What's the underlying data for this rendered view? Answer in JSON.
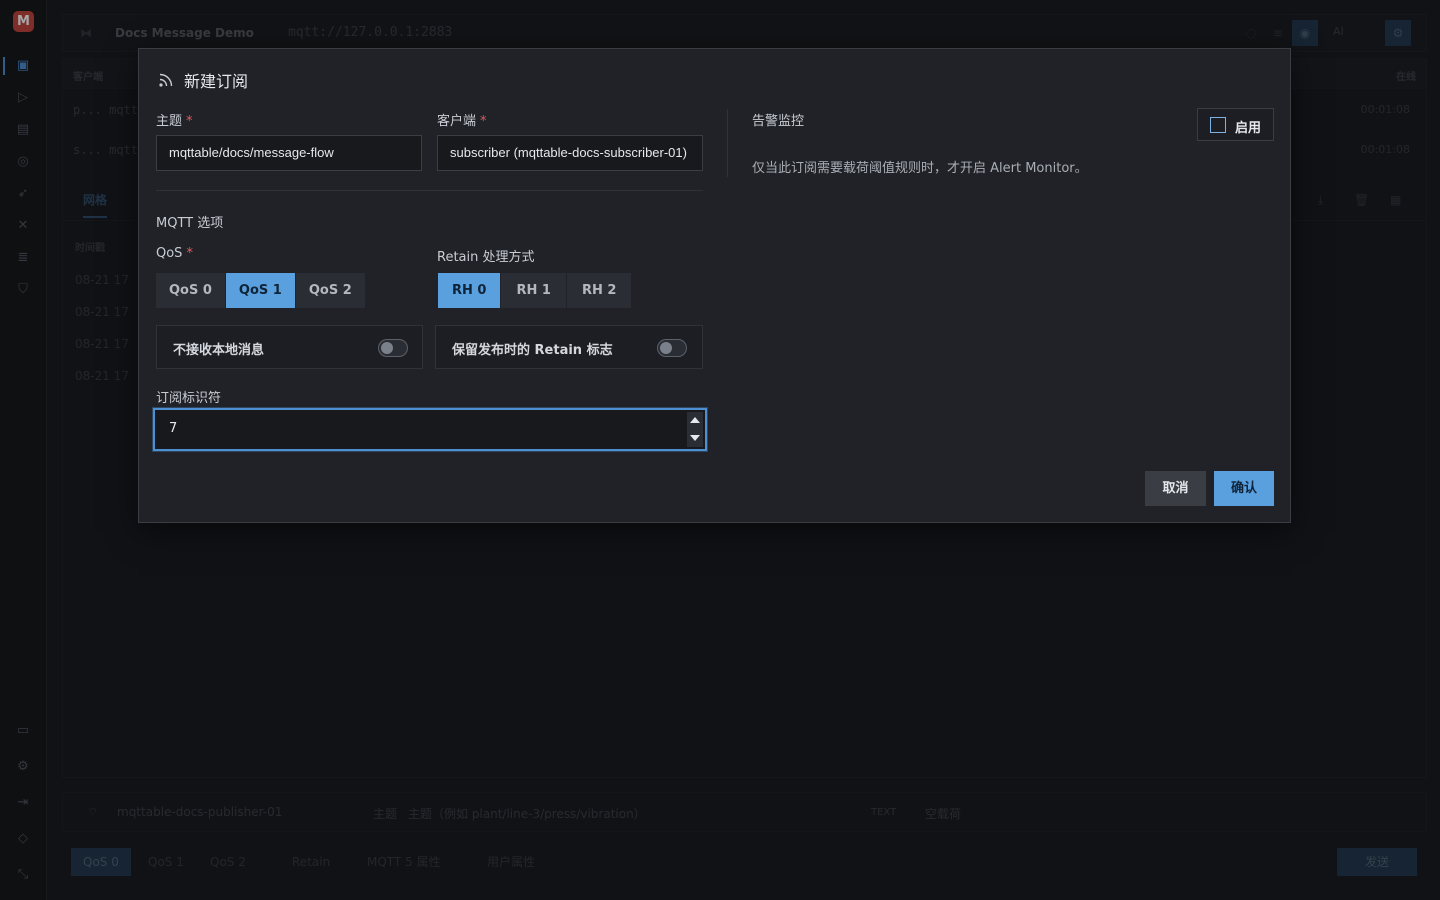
{
  "app": {
    "logo_letter": "M",
    "window_title": "Docs Message Demo",
    "broker_url": "mqtt://127.0.0.1:2883",
    "ai_label": "AI"
  },
  "background": {
    "clients_header": "客户端",
    "online_header": "在线",
    "clients": [
      {
        "name": "p... mqtta",
        "time": "00:01:08"
      },
      {
        "name": "s... mqtta",
        "time": "00:01:08"
      }
    ],
    "tab_grid": "网格",
    "time_header": "时间戳",
    "timestamps": [
      "08-21 17",
      "08-21 17",
      "08-21 17",
      "08-21 17"
    ],
    "composer": {
      "client": "mqttable-docs-publisher-01",
      "topic_label": "主题",
      "topic_placeholder": "主题（例如 plant/line-3/press/vibration）",
      "format": "TEXT",
      "payload_placeholder": "空载荷",
      "qos": [
        "QoS 0",
        "QoS 1",
        "QoS 2"
      ],
      "retain": "Retain",
      "mqtt5": "MQTT 5 属性",
      "user_props": "用户属性",
      "send": "发送"
    }
  },
  "modal": {
    "title": "新建订阅",
    "topic": {
      "label": "主题",
      "required": "*",
      "value": "mqttable/docs/message-flow"
    },
    "client": {
      "label": "客户端",
      "required": "*",
      "value": "subscriber (mqttable-docs-subscriber-01)"
    },
    "mqtt_options_title": "MQTT 选项",
    "qos": {
      "label": "QoS",
      "required": "*",
      "options": [
        "QoS 0",
        "QoS 1",
        "QoS 2"
      ],
      "selected": 1
    },
    "retain_handling": {
      "label": "Retain 处理方式",
      "options": [
        "RH 0",
        "RH 1",
        "RH 2"
      ],
      "selected": 0
    },
    "no_local": {
      "label": "不接收本地消息",
      "enabled": false
    },
    "retain_as_published": {
      "label": "保留发布时的 Retain 标志",
      "enabled": false
    },
    "subscription_identifier": {
      "label": "订阅标识符",
      "value": "7"
    },
    "alert": {
      "title": "告警监控",
      "description": "仅当此订阅需要载荷阈值规则时，才开启 Alert Monitor。",
      "enable_label": "启用",
      "checked": false
    },
    "cancel_label": "取消",
    "confirm_label": "确认"
  },
  "colors": {
    "accent": "#5aa0de",
    "required": "#e35d5d",
    "danger_logo": "#c2453f"
  }
}
